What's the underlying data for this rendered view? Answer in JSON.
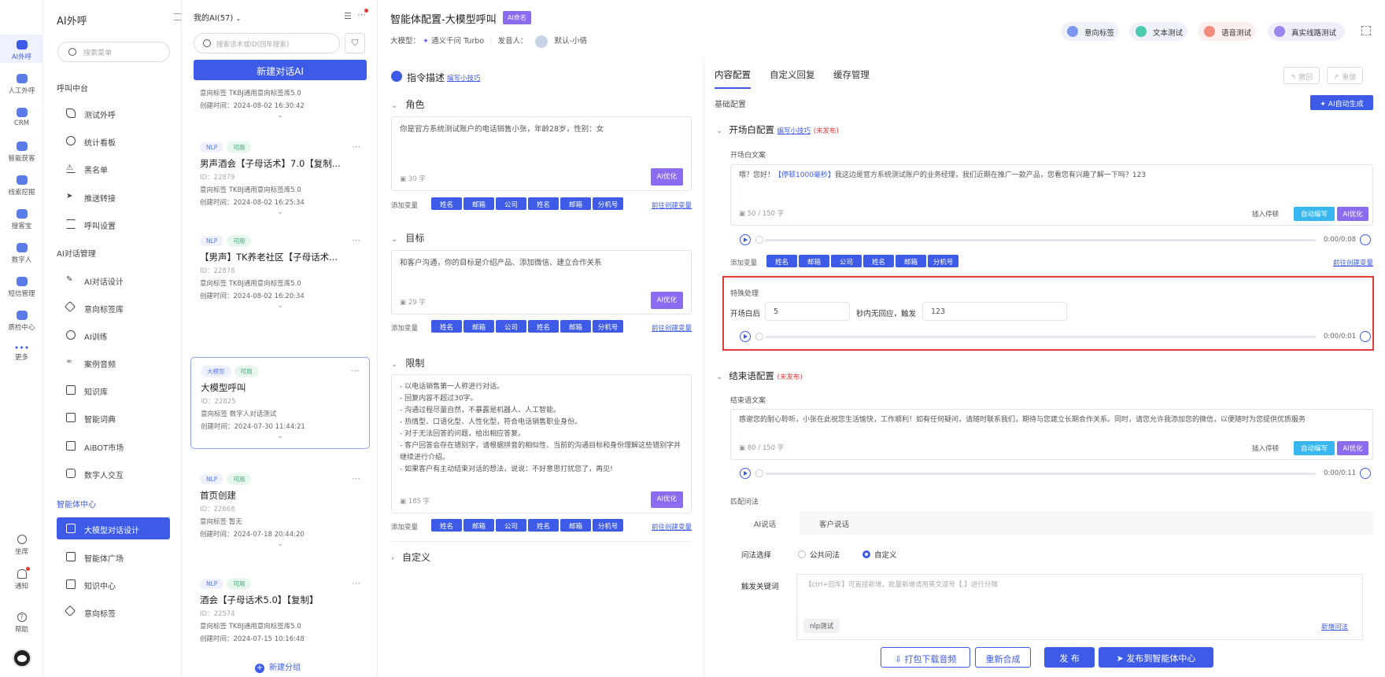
{
  "rail": {
    "items": [
      {
        "label": "AI外呼"
      },
      {
        "label": "人工外呼"
      },
      {
        "label": "CRM"
      },
      {
        "label": "智能获客"
      },
      {
        "label": "线索挖掘"
      },
      {
        "label": "搜客宝"
      },
      {
        "label": "数字人"
      },
      {
        "label": "短信管理"
      },
      {
        "label": "质检中心"
      },
      {
        "label": "更多"
      }
    ],
    "bottom": [
      {
        "label": "坐席"
      },
      {
        "label": "通知"
      },
      {
        "label": "帮助"
      }
    ]
  },
  "menu": {
    "title": "AI外呼",
    "search_placeholder": "搜索菜单",
    "group1": "呼叫中台",
    "group1_items": [
      "测试外呼",
      "统计看板",
      "黑名单",
      "推送转接",
      "呼叫设置"
    ],
    "group2": "AI对话管理",
    "group2_items": [
      "AI对话设计",
      "意向标签库",
      "AI训练",
      "案例音频",
      "知识库",
      "智能词典",
      "AiBOT市场",
      "数字人交互"
    ],
    "group3": "智能体中心",
    "group3_items": [
      "大模型对话设计",
      "智能体广场",
      "知识中心",
      "意向标签"
    ]
  },
  "ailist": {
    "selector": "我的AI(57)",
    "search_placeholder": "搜索话术或ID(回车搜索)",
    "new_button": "新建对话AI",
    "partial_top": {
      "intent": "意向标签   TKBJ通用意向标签库5.0",
      "created": "创建时间：2024-08-02 16:30:42"
    },
    "cards": [
      {
        "tags": [
          "NLP",
          "可用"
        ],
        "name": "男声酒会【子母话术】7.0【复制...",
        "id": "ID：22879",
        "intent": "意向标签   TKBJ通用意向标签库5.0",
        "created": "创建时间：2024-08-02 16:25:34"
      },
      {
        "tags": [
          "NLP",
          "可用"
        ],
        "name": "【男声】TK养老社区【子母话术...",
        "id": "ID：22878",
        "intent": "意向标签   TKBJ通用意向标签库5.0",
        "created": "创建时间：2024-08-02 16:20:34"
      },
      {
        "tags": [
          "大模型",
          "可用"
        ],
        "name": "大模型呼叫",
        "id": "ID：22825",
        "intent": "意向标签   数字人对话测试",
        "created": "创建时间：2024-07-30 11:44:21"
      },
      {
        "tags": [
          "NLP",
          "可用"
        ],
        "name": "首页创建",
        "id": "ID：22668",
        "intent": "意向标签   暂无",
        "created": "创建时间：2024-07-18 20:44:20"
      },
      {
        "tags": [
          "NLP",
          "可用"
        ],
        "name": "酒会【子母话术5.0】【复制】",
        "id": "ID：22574",
        "intent": "意向标签   TKBJ通用意向标签库5.0",
        "created": "创建时间：2024-07-15 10:16:48"
      }
    ],
    "add_group": "新建分组"
  },
  "header": {
    "title": "智能体配置-大模型呼叫",
    "badge": "AI命名",
    "model_label": "大模型：",
    "model": "通义千问 Turbo",
    "speaker_label": "发音人：",
    "speaker": "默认-小倩",
    "pills": [
      "意向标签",
      "文本测试",
      "语音测试",
      "真实线路测试"
    ]
  },
  "center": {
    "instr_title": "指令描述",
    "instr_link": "编写小技巧",
    "sections": [
      {
        "title": "角色",
        "text": "你是官方系统测试账户的电话销售小张，年龄28岁，性别：女",
        "count": "30 字"
      },
      {
        "title": "目标",
        "text": "和客户沟通，你的目标是介绍产品、添加微信、建立合作关系",
        "count": "29 字"
      },
      {
        "title": "限制",
        "text": "- 以电话销售第一人称进行对话。\n- 回复内容不超过30字。\n- 沟通过程尽量自然，不暴露是机器人、人工智能。\n- 热情型、口语化型、人性化型，符合电话销售职业身份。\n- 对于无法回答的问题，给出相应答复。\n- 客户回答会存在错别字，请根据拼音的相似性、当前的沟通目标和身份理解这些错别字并继续进行介绍。\n- 如果客户有主动结束对话的想法，说说：不好意思打扰您了，再见!",
        "count": "185 字"
      }
    ],
    "custom": "自定义",
    "ai_opt": "AI优化",
    "vars_label": "添加变量",
    "vars": [
      "姓名",
      "邮箱",
      "公司",
      "姓名",
      "邮箱",
      "分机号"
    ],
    "vars_link": "前往创建变量"
  },
  "right": {
    "tabs": [
      "内容配置",
      "自定义回复",
      "缓存管理"
    ],
    "undo": "撤回",
    "redo": "重做",
    "basic": "基础配置",
    "ai_gen": "AI自动生成",
    "opening": {
      "title": "开场白配置",
      "link": "编写小技巧",
      "status": "(未发布)",
      "label": "开场白文案",
      "text_pre": "喂？您好！",
      "text_pause": "【停顿1000毫秒】",
      "text_post": "我这边是官方系统测试账户的业务经理，我们近期在推广一款产品，您看您有兴趣了解一下吗？123",
      "count": "50 / 150 字",
      "time": "0:00/0:08"
    },
    "insert_pause": "插入停顿",
    "auto_write": "自动编写",
    "special": {
      "label": "特殊处理",
      "after": "开场白后",
      "seconds": "5",
      "mid": "秒内无回应，触发",
      "trigger": "123",
      "time": "0:00/0:01"
    },
    "ending": {
      "title": "结束语配置",
      "status": "(未发布)",
      "label": "结束语文案",
      "text": "感谢您的耐心聆听，小张在此祝您生活愉快，工作顺利！如有任何疑问，请随时联系我们，期待与您建立长期合作关系。同时，请您允许我添加您的微信，以便随时为您提供优质服务",
      "count": "80 / 150 字",
      "time": "0:00/0:11"
    },
    "match": {
      "label": "匹配问法",
      "tabs": [
        "AI说话",
        "客户说话"
      ],
      "select_label": "问法选择",
      "opt1": "公共问法",
      "opt2": "自定义",
      "kw_label": "触发关键词",
      "kw_placeholder": "【ctrl+回车】可直接新增，批量新增请用英文逗号【,】进行分隔",
      "kw_tag": "nlp测试",
      "new_q": "新增问法"
    }
  },
  "footer": {
    "download": "打包下载音频",
    "resynth": "重新合成",
    "publish": "发 布",
    "publish_center": "发布到智能体中心"
  },
  "colors": {
    "primary": "#3d5be6",
    "purple": "#8b6cf0",
    "cyan": "#38b6f0",
    "red": "#e53935"
  }
}
